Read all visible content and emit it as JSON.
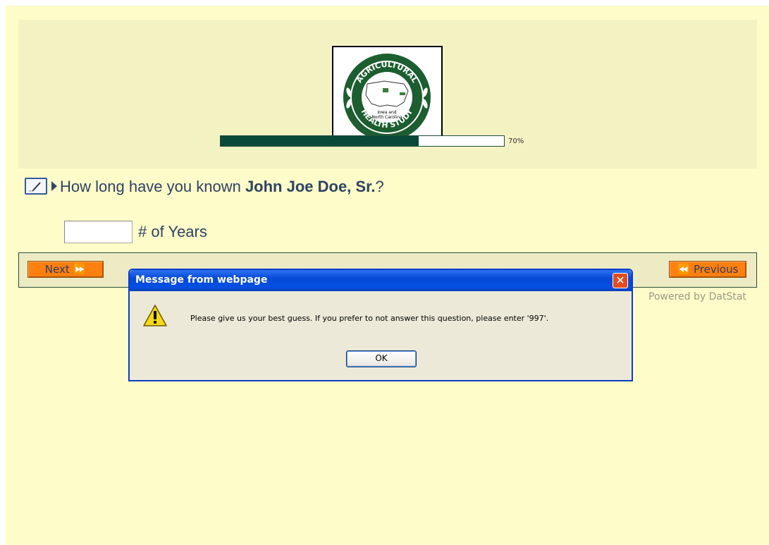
{
  "logo": {
    "top_arc_text": "AGRICULTURAL",
    "bottom_arc_text": "HEALTH STUDY",
    "center_line1": "Iowa and",
    "center_line2": "North Carolina"
  },
  "progress": {
    "value": 0.7,
    "label": "70%"
  },
  "question": {
    "prefix": "How long have you known ",
    "name": "John Joe Doe, Sr.",
    "suffix": "?"
  },
  "answer": {
    "value": "",
    "unit_label": "# of Years"
  },
  "nav": {
    "next_label": "Next ⏩",
    "previous_label": "⏪ Previous"
  },
  "footer": {
    "powered_by": "Powered by DatStat"
  },
  "dialog": {
    "title": "Message from webpage",
    "message": "Please give us your best guess.  If you prefer to not answer this question, please enter '997'.",
    "ok_label": "OK",
    "close_label": "✕"
  },
  "colors": {
    "page_bg": "#fefcc8",
    "header_bg": "#f3f2c2",
    "progress_fill": "#08493a",
    "nav_button": "#ff7f0f",
    "dialog_title_bar": "#0450e2"
  },
  "icons": {
    "edit": "pencil-icon",
    "question_marker": "play-triangle-icon",
    "warning": "warning-icon",
    "close": "close-icon"
  }
}
